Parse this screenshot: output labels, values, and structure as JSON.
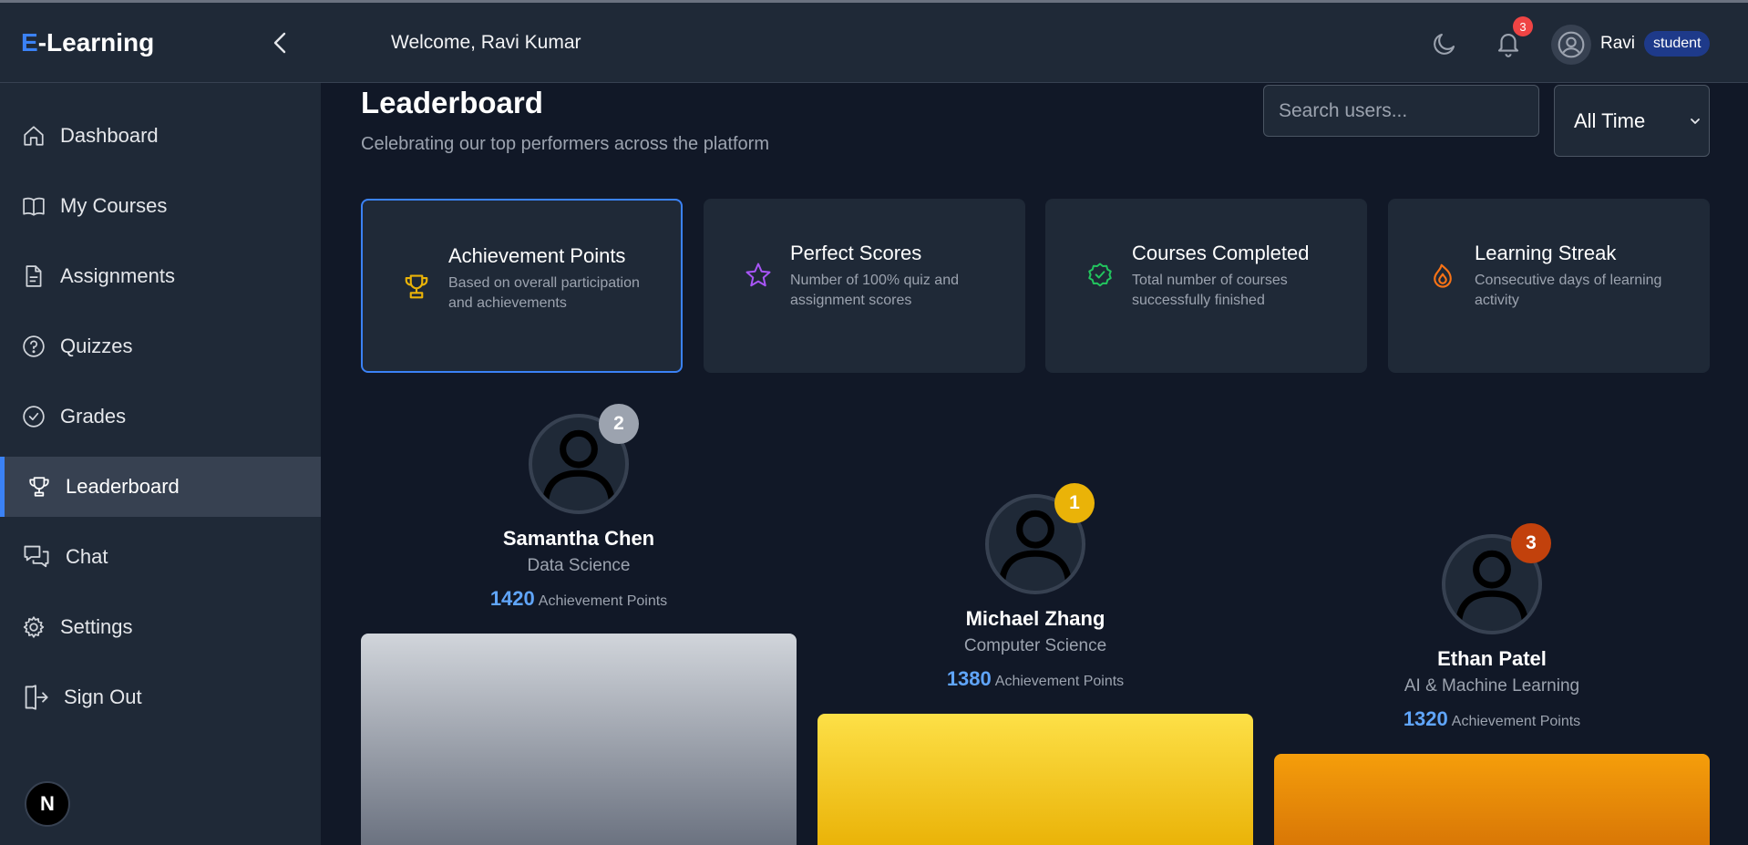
{
  "app": {
    "brand_prefix": "E",
    "brand_suffix": "-Learning"
  },
  "sidebar": {
    "items": [
      {
        "label": "Dashboard",
        "icon": "home-icon"
      },
      {
        "label": "My Courses",
        "icon": "book-icon"
      },
      {
        "label": "Assignments",
        "icon": "document-icon"
      },
      {
        "label": "Quizzes",
        "icon": "question-icon"
      },
      {
        "label": "Grades",
        "icon": "check-circle-icon"
      },
      {
        "label": "Leaderboard",
        "icon": "trophy-icon",
        "active": true
      },
      {
        "label": "Chat",
        "icon": "chat-icon"
      },
      {
        "label": "Settings",
        "icon": "gear-icon"
      },
      {
        "label": "Sign Out",
        "icon": "sign-out-icon"
      }
    ],
    "next_badge": "N"
  },
  "header": {
    "welcome": "Welcome, Ravi Kumar",
    "notification_count": "3",
    "user_name": "Ravi",
    "role": "student"
  },
  "main": {
    "title": "Leaderboard",
    "subtitle": "Celebrating our top performers across the platform",
    "search_placeholder": "Search users...",
    "time_filter": "All Time",
    "categories": [
      {
        "title": "Achievement Points",
        "desc": "Based on overall participation and achievements",
        "icon": "trophy-icon",
        "color": "#eab308",
        "active": true
      },
      {
        "title": "Perfect Scores",
        "desc": "Number of 100% quiz and assignment scores",
        "icon": "star-icon",
        "color": "#a855f7"
      },
      {
        "title": "Courses Completed",
        "desc": "Total number of courses successfully finished",
        "icon": "badge-check-icon",
        "color": "#22c55e"
      },
      {
        "title": "Learning Streak",
        "desc": "Consecutive days of learning activity",
        "icon": "flame-icon",
        "color": "#f97316"
      }
    ],
    "podium": [
      {
        "rank": "2",
        "name": "Samantha Chen",
        "dept": "Data Science",
        "points": "1420",
        "points_label": "Achievement Points",
        "badge_color": "#9ca3af"
      },
      {
        "rank": "1",
        "name": "Michael Zhang",
        "dept": "Computer Science",
        "points": "1380",
        "points_label": "Achievement Points",
        "badge_color": "#eab308"
      },
      {
        "rank": "3",
        "name": "Ethan Patel",
        "dept": "AI & Machine Learning",
        "points": "1320",
        "points_label": "Achievement Points",
        "badge_color": "#c2410c"
      }
    ]
  }
}
